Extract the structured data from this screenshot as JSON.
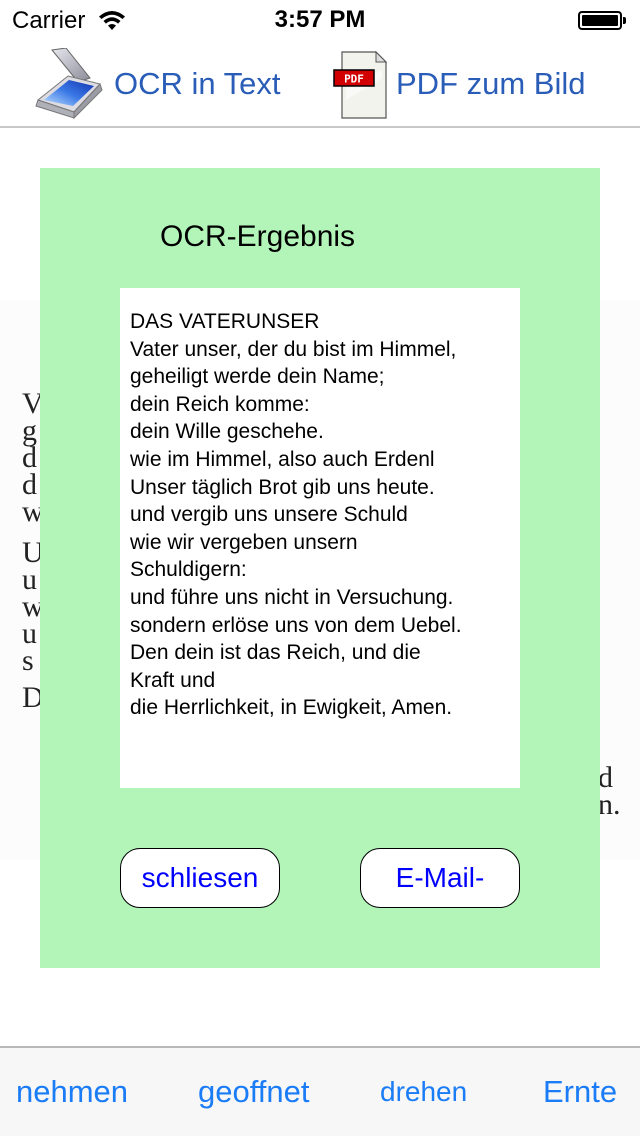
{
  "status_bar": {
    "carrier": "Carrier",
    "time": "3:57 PM",
    "wifi_icon": "wifi-icon",
    "battery_icon": "battery-full-icon",
    "battery_level": 1.0
  },
  "top_bar": {
    "ocr_button": {
      "label": "OCR in Text",
      "icon": "scanner-icon"
    },
    "pdf_button": {
      "label": "PDF zum Bild",
      "icon": "pdf-document-icon"
    }
  },
  "background_document": {
    "left_fragments": [
      "V",
      "g",
      "d",
      "d",
      "w",
      "",
      "U",
      "u",
      "w",
      "u",
      "s",
      "D"
    ],
    "right_fragments": [
      "d",
      "n."
    ]
  },
  "ocr_panel": {
    "title": "OCR-Ergebnis",
    "result_text": "DAS VATERUNSER\nVater unser, der du bist im Himmel,\ngeheiligt werde dein Name;\ndein Reich komme:\ndein Wille geschehe.\nwie im Himmel, also auch Erdenl\nUnser täglich Brot gib uns heute.\nund vergib uns unsere Schuld\nwie wir vergeben unsern\nSchuldigern:\nund führe uns nicht in Versuchung.\nsondern erlöse uns von dem Uebel.\nDen dein ist das Reich, und die\nKraft und\ndie Herrlichkeit, in Ewigkeit, Amen.",
    "close_button": "schliesen",
    "email_button": "E-Mail-",
    "background_color": "#b3f5b9"
  },
  "bottom_bar": {
    "items": [
      {
        "label": "nehmen"
      },
      {
        "label": "geoffnet"
      },
      {
        "label": "drehen"
      },
      {
        "label": "Ernte"
      }
    ],
    "tint_color": "#1a7cf6"
  }
}
